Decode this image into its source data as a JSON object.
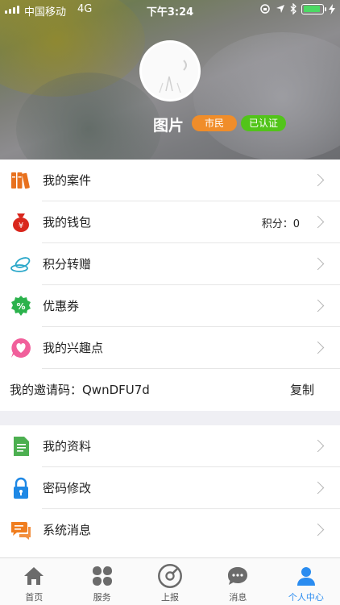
{
  "status_bar": {
    "carrier": "中国移动",
    "network": "4G",
    "time": "下午3:24"
  },
  "profile": {
    "name": "图片",
    "badges": [
      "市民",
      "已认证"
    ]
  },
  "menu_group1": [
    {
      "label": "我的案件",
      "icon": "case-books-icon"
    },
    {
      "label": "我的钱包",
      "icon": "money-bag-icon",
      "extra": "积分：0"
    },
    {
      "label": "积分转赠",
      "icon": "points-transfer-icon"
    },
    {
      "label": "优惠券",
      "icon": "coupon-percent-icon"
    },
    {
      "label": "我的兴趣点",
      "icon": "heart-chat-icon"
    }
  ],
  "invite": {
    "label": "我的邀请码：QwnDFU7d",
    "copy_label": "复制"
  },
  "menu_group2": [
    {
      "label": "我的资料",
      "icon": "document-icon"
    },
    {
      "label": "密码修改",
      "icon": "lock-icon"
    },
    {
      "label": "系统消息",
      "icon": "message-icon"
    }
  ],
  "tabs": [
    {
      "label": "首页",
      "icon": "home-icon",
      "active": false
    },
    {
      "label": "服务",
      "icon": "services-icon",
      "active": false
    },
    {
      "label": "上报",
      "icon": "report-icon",
      "active": false
    },
    {
      "label": "消息",
      "icon": "chat-icon",
      "active": false
    },
    {
      "label": "个人中心",
      "icon": "profile-icon",
      "active": true
    }
  ],
  "colors": {
    "accent": "#2a8cf0",
    "badge_citizen": "#f08d2a",
    "badge_verified": "#52c41a"
  }
}
